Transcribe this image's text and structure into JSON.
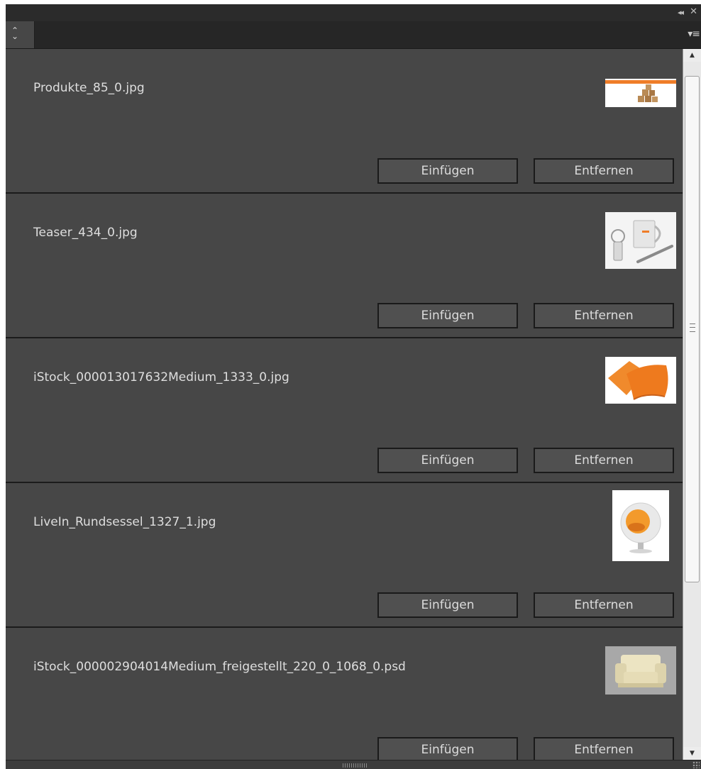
{
  "panel": {
    "title_buttons": {
      "collapse": "◂◂",
      "close": "✕"
    },
    "tab_icon": "updown-arrows-icon",
    "menu_icon": "panel-menu-icon"
  },
  "items": [
    {
      "filename": "Produkte_85_0.jpg",
      "insert_label": "Einfügen",
      "remove_label": "Entfernen",
      "thumbnail": "boxes-thumbnail"
    },
    {
      "filename": "Teaser_434_0.jpg",
      "insert_label": "Einfügen",
      "remove_label": "Entfernen",
      "thumbnail": "mug-keychain-pen-thumbnail"
    },
    {
      "filename": "iStock_000013017632Medium_1333_0.jpg",
      "insert_label": "Einfügen",
      "remove_label": "Entfernen",
      "thumbnail": "orange-pillows-thumbnail"
    },
    {
      "filename": "LiveIn_Rundsessel_1327_1.jpg",
      "insert_label": "Einfügen",
      "remove_label": "Entfernen",
      "thumbnail": "ball-chair-thumbnail"
    },
    {
      "filename": "iStock_000002904014Medium_freigestellt_220_0_1068_0.psd",
      "insert_label": "Einfügen",
      "remove_label": "Entfernen",
      "thumbnail": "armchair-thumbnail"
    }
  ],
  "colors": {
    "panel_bg": "#474747",
    "button_bg": "#505050",
    "accent_orange": "#ef7d28"
  }
}
